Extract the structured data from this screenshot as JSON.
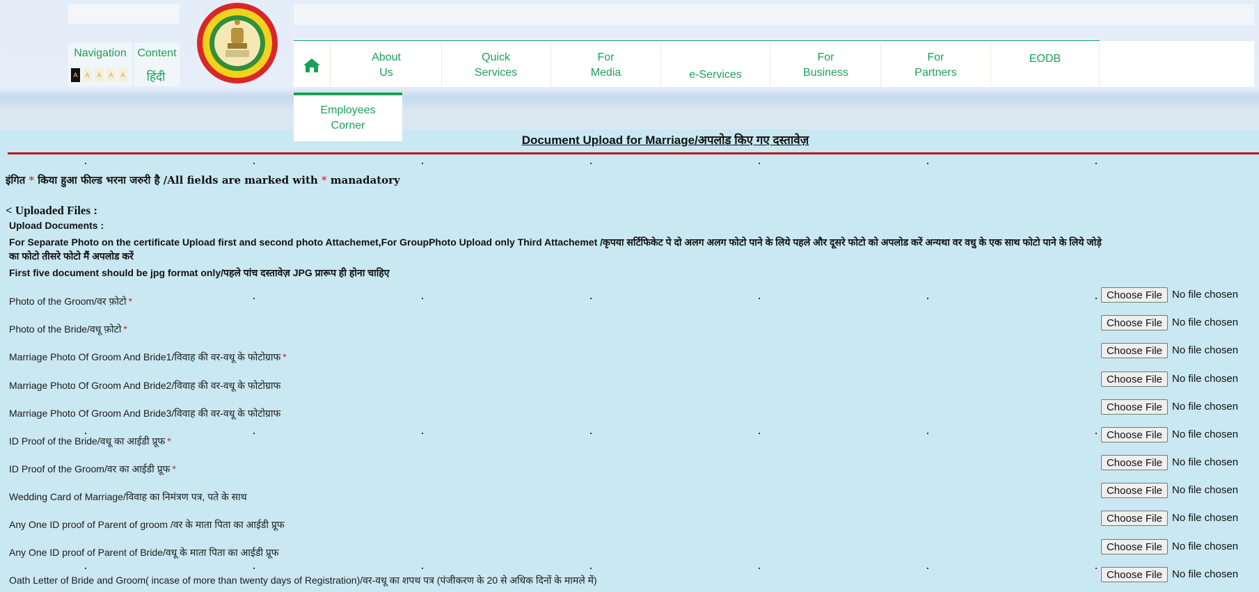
{
  "header": {
    "navigation_label": "Navigation",
    "content_label": "Content",
    "hindi_label": "हिंदी",
    "font_sizes": [
      "A",
      "A",
      "A",
      "A",
      "A"
    ],
    "menu": [
      {
        "line1": "",
        "line2": "",
        "icon": "home-icon"
      },
      {
        "line1": "About",
        "line2": "Us"
      },
      {
        "line1": "Quick",
        "line2": "Services"
      },
      {
        "line1": "For",
        "line2": "Media"
      },
      {
        "line1": "",
        "line2": "e-Services"
      },
      {
        "line1": "For",
        "line2": "Business"
      },
      {
        "line1": "For",
        "line2": "Partners"
      },
      {
        "line1": "EODB",
        "line2": ""
      }
    ],
    "employees": {
      "line1": "Employees",
      "line2": "Corner"
    }
  },
  "page": {
    "title": "Document Upload for Marriage/अपलोड किए गए दस्तावेज़",
    "mandatory_prefix": "इंगित",
    "mandatory_mid": "किया हुआ फील्ड भरना जरुरी है /All fields are marked with",
    "mandatory_suffix": "manadatory",
    "star": "*",
    "uploaded_files": "< Uploaded Files :",
    "upload_documents": "Upload Documents :",
    "note": "For Separate Photo on the certificate Upload first and second photo Attachemet,For GroupPhoto Upload only Third Attachemet /कृपया सर्टिफिकेट पे दो अलग अलग फोटो पाने के लिये पहले और दूसरे फोटो को अपलोड करें अन्यथा वर वधु के एक साथ फोटो पाने के लिये जोड़े का फोटो तीसरे फोटो मैं अपलोड करें",
    "first_five": "First five document should be jpg format only/पहले पांच दस्तावेज़ JPG प्रारूप ही होना चाहिए"
  },
  "file_input": {
    "button": "Choose File",
    "status": "No file chosen"
  },
  "documents": [
    {
      "label": "Photo of the Groom/वर फ़ोटो",
      "required": "*"
    },
    {
      "label": "Photo of the Bride/वधू फ़ोटो",
      "required": "*"
    },
    {
      "label": "Marriage Photo Of Groom And Bride1/विवाह की वर-वधू के फोटोग्राफ",
      "required": "*"
    },
    {
      "label": "Marriage Photo Of Groom And Bride2/विवाह की वर-वधू के फोटोग्राफ",
      "required": ""
    },
    {
      "label": "Marriage Photo Of Groom And Bride3/विवाह की वर-वधू के फोटोग्राफ",
      "required": ""
    },
    {
      "label": "ID Proof of the Bride/वधू का आईडी प्रूफ",
      "required": "*"
    },
    {
      "label": "ID Proof of the Groom/वर का आईडी प्रूफ",
      "required": "*"
    },
    {
      "label": "Wedding Card of Marriage/विवाह का निमंत्रण पत्र, पते के साथ",
      "required": ""
    },
    {
      "label": "Any One ID proof of Parent of groom /वर के माता पिता का आईडी प्रूफ",
      "required": ""
    },
    {
      "label": "Any One ID proof of Parent of Bride/वधू के माता पिता का आईडी प्रूफ",
      "required": ""
    },
    {
      "label": "Oath Letter of Bride and Groom( incase of more than twenty days of Registration)/वर-वधू का शपथ पत्र (पंजीकरण के 20 से अधिक दिनों के मामले में)",
      "required": ""
    }
  ],
  "colors": {
    "accent": "#1aa157",
    "rule": "#c0141a",
    "required": "#d8141a",
    "background": "#c9e8f2"
  }
}
